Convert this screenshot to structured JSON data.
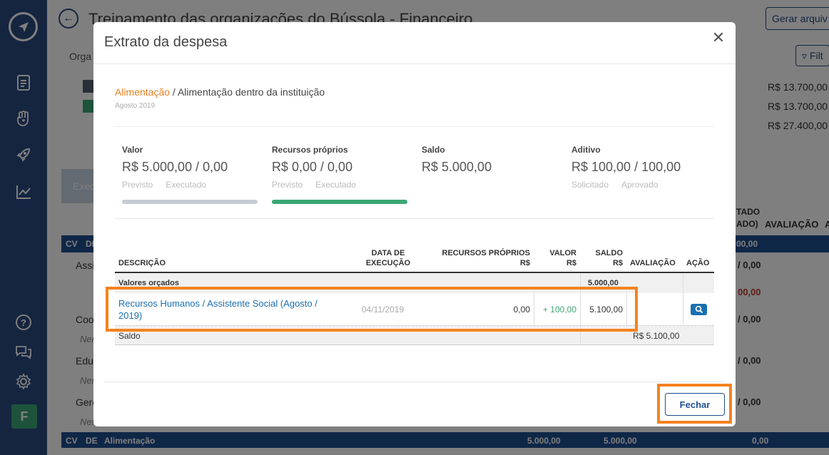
{
  "page": {
    "title": "Treinamento das organizações do Bússola - Financeiro",
    "generate_button": "Gerar arquiv",
    "filter_button": "Filt",
    "org_tab": "Orga",
    "exec_tab": "Exec",
    "summary_values": [
      "R$ 13.700,00",
      "R$ 13.700,00",
      "R$ 27.400,00"
    ],
    "bg_header_col_1": "TADO",
    "bg_header_col_2": "ADO)",
    "bg_header_avaliacao": "AVALIAÇÃO",
    "bg_header_tail": "A",
    "bg_header_value": "00,00",
    "bg_bar_cv": "CV",
    "bg_bar_de": "DE",
    "bg_rows": [
      {
        "label": "Assis",
        "value": "/ 0,00",
        "red": false
      },
      {
        "label": "",
        "value": "00,00",
        "red": true
      },
      {
        "label": "Coor",
        "value": "/ 0,00",
        "red": false
      },
      {
        "label": "Ner",
        "value": "",
        "red": false
      },
      {
        "label": "Educ",
        "value": "/ 0,00",
        "red": false
      },
      {
        "label": "Ner",
        "value": "",
        "red": false
      },
      {
        "label": "Gere",
        "value": "/ 0,00",
        "red": false
      },
      {
        "label": "Ner",
        "value": "",
        "red": false
      }
    ],
    "bottom_bar": {
      "cv": "CV",
      "de": "DE",
      "label": "Alimentação",
      "v1": "5.000,00",
      "v2": "5.000,00",
      "v3": "0,00"
    }
  },
  "sidebar": {
    "icons": [
      "navigation-icon",
      "document-icon",
      "hand-heart-icon",
      "rocket-icon",
      "chart-icon",
      "help-icon",
      "chat-icon",
      "settings-icon"
    ],
    "avatar": "F"
  },
  "modal": {
    "title": "Extrato da despesa",
    "breadcrumb_link": "Alimentação",
    "breadcrumb_rest": " / Alimentação dentro da instituição",
    "period": "Agosto 2019",
    "stats": [
      {
        "label": "Valor",
        "value": "R$ 5.000,00 / 0,00",
        "sub1": "Previsto",
        "sub2": "Executado"
      },
      {
        "label": "Recursos próprios",
        "value": "R$ 0,00 / 0,00",
        "sub1": "Previsto",
        "sub2": "Executado"
      },
      {
        "label": "Saldo",
        "value": "R$ 5.000,00",
        "sub1": "",
        "sub2": ""
      },
      {
        "label": "Aditivo",
        "value": "R$ 100,00 / 100,00",
        "sub1": "Solicitado",
        "sub2": "Aprovado"
      }
    ],
    "progress": {
      "valor_fraction": 0,
      "recursos_fraction": 1
    },
    "colors": {
      "valor_bar": "#c5ccd6",
      "recursos_bar": "#3aa774",
      "accent": "#e67e22",
      "link": "#1a6fb0",
      "highlight": "#f58220"
    },
    "table": {
      "headers": {
        "descricao": "DESCRIÇÃO",
        "data_1": "DATA DE",
        "data_2": "EXECUÇÃO",
        "recursos_1": "RECURSOS PRÓPRIOS",
        "recursos_2": "R$",
        "valor_1": "VALOR",
        "valor_2": "R$",
        "saldo_1": "SALDO",
        "saldo_2": "R$",
        "avaliacao": "AVALIAÇÃO",
        "acao": "AÇÃO"
      },
      "orcados_label": "Valores orçados",
      "orcados_saldo": "5.000,00",
      "row": {
        "descricao": "Recursos Humanos / Assistente Social (Agosto / 2019)",
        "data": "04/11/2019",
        "recursos": "0,00",
        "valor": "+ 100,00",
        "saldo": "5.100,00"
      },
      "saldo_label": "Saldo",
      "saldo_total": "R$ 5.100,00"
    },
    "close_button": "Fechar"
  }
}
